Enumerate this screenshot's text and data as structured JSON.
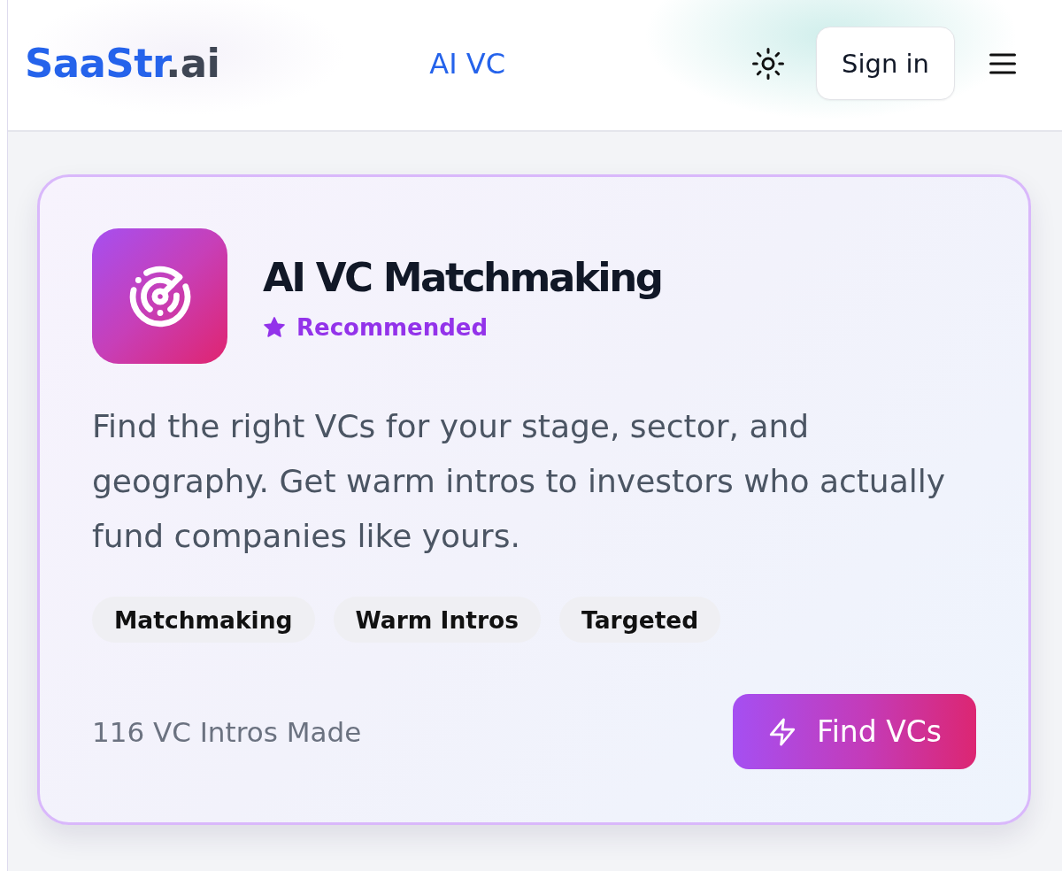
{
  "header": {
    "logo": {
      "brand": "SaaStr",
      "suffix": ".ai"
    },
    "nav_link": "AI VC",
    "sign_in": "Sign in"
  },
  "card": {
    "title": "AI VC Matchmaking",
    "badge": "Recommended",
    "description": "Find the right VCs for your stage, sector, and geography. Get warm intros to investors who actually fund companies like yours.",
    "tags": [
      "Matchmaking",
      "Warm Intros",
      "Targeted"
    ],
    "stat": "116 VC Intros Made",
    "action": "Find VCs"
  }
}
